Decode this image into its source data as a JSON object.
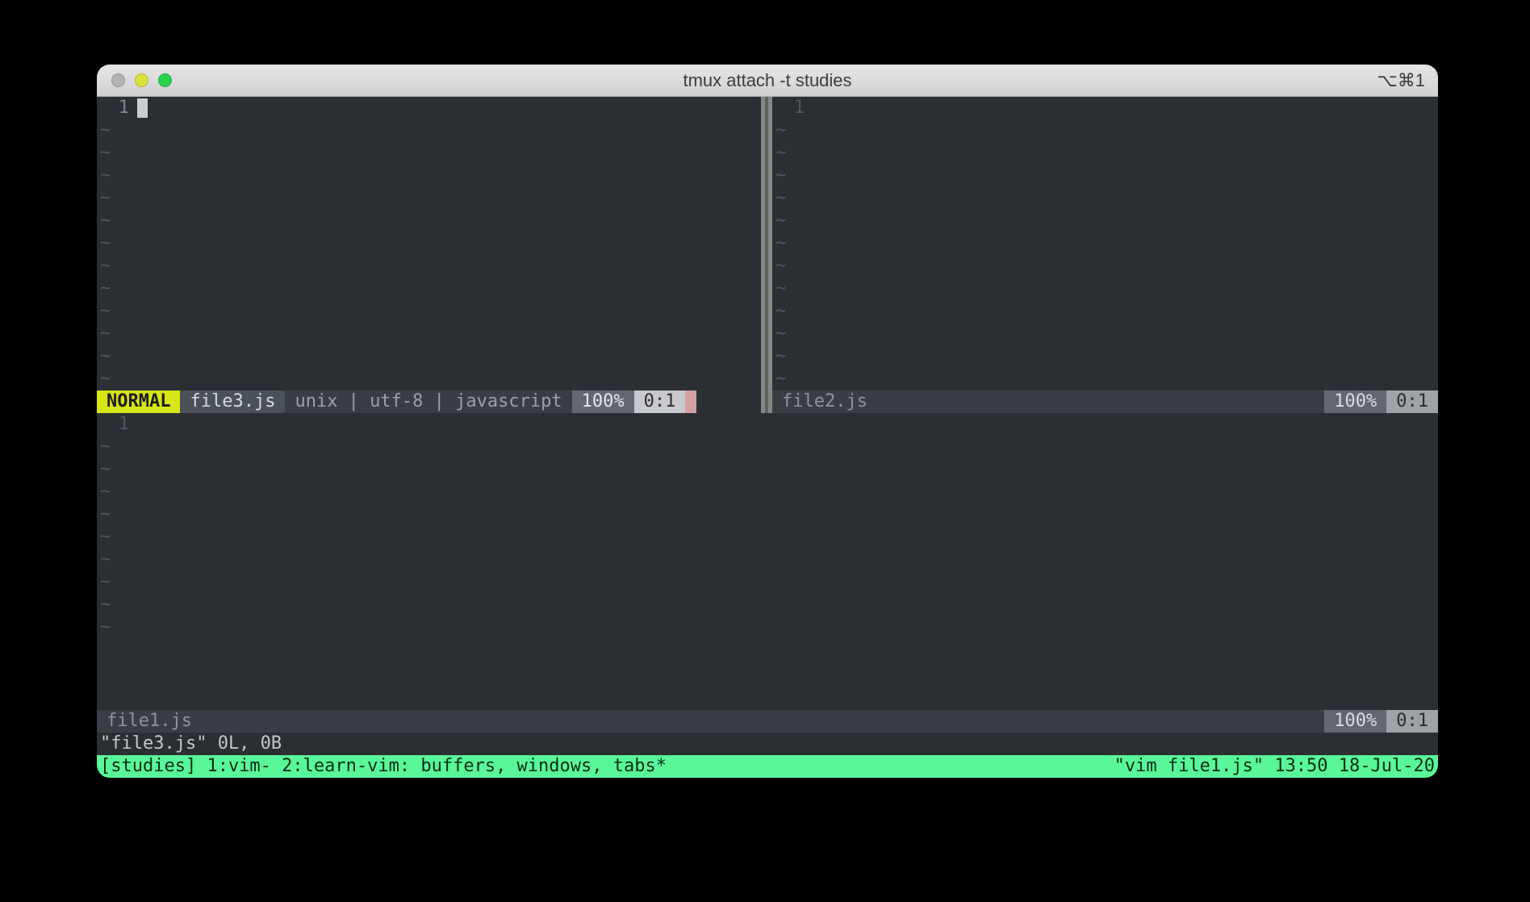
{
  "titlebar": {
    "title": "tmux attach -t studies",
    "shortcut": "⌥⌘1"
  },
  "panes": {
    "top_left": {
      "line_number": "1",
      "tilde_rows": 13,
      "status": {
        "mode": "NORMAL",
        "file": "file3.js",
        "meta": "unix | utf-8 | javascript",
        "percent": "100%",
        "pos": "0:1"
      }
    },
    "top_right": {
      "line_number": "1",
      "tilde_rows": 13,
      "status": {
        "file": "file2.js",
        "percent": "100%",
        "pos": "0:1"
      }
    },
    "bottom": {
      "line_number": "1",
      "tilde_rows": 9,
      "status": {
        "file": "file1.js",
        "percent": "100%",
        "pos": "0:1"
      }
    }
  },
  "cmdline": "\"file3.js\" 0L, 0B",
  "tmux": {
    "left": "[studies] 1:vim- 2:learn-vim: buffers, windows, tabs*",
    "right": "\"vim file1.js\" 13:50 18-Jul-20"
  }
}
